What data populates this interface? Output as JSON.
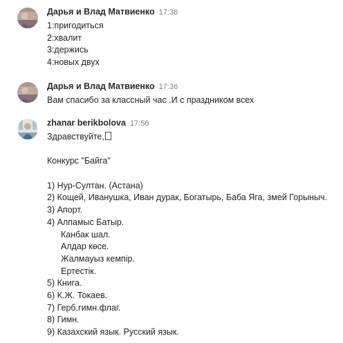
{
  "messages": [
    {
      "author": "Дарья и Влад Матвиенко",
      "time": "17:36",
      "lines": [
        "1:пригодиться",
        "2:хвалит",
        "3:держись",
        "4:новых двух"
      ]
    },
    {
      "author": "Дарья и Влад Матвиенко",
      "time": "17:36",
      "lines": [
        "Вам спасибо за классный час .И с праздником всех"
      ]
    },
    {
      "author": "zhanar berikbolova",
      "time": "17:56",
      "greeting": "Здравствуйте,",
      "contest_title": "Конкурс \"Байга\"",
      "answers": [
        "1) Нур-Султан. (Астана)",
        "2) Кощей, Иванушка, Иван дурак, Богатырь, Баба Яга, змей Горыныч.",
        "3) Апорт.",
        "4) Алпамыс Батыр."
      ],
      "sub_answers": [
        "Канбак шал.",
        "Алдар көсе.",
        "Жалмауыз кемпір.",
        "Ертестік."
      ],
      "answers_cont": [
        "5) Книга.",
        "6) К.Ж. Токаев.",
        "7) Герб.гимн.флаг.",
        "8) Гимн.",
        "9) Казахский язык. Русский язык."
      ]
    }
  ],
  "colors": {
    "author": "#2b2b2b",
    "time": "#808080",
    "text": "#222222",
    "background": "#ffffff"
  }
}
